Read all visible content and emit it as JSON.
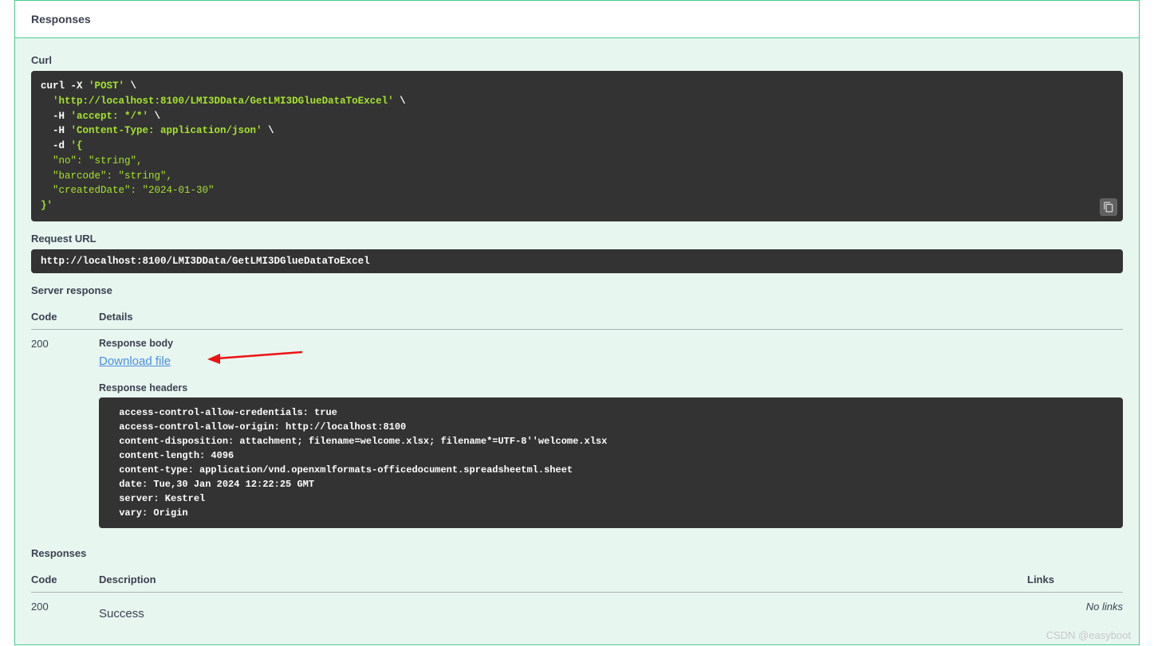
{
  "header": {
    "title": "Responses"
  },
  "curl": {
    "label": "Curl",
    "prefix": "curl -X ",
    "method": "'POST'",
    "slash": " \\",
    "url": "'http://localhost:8100/LMI3DData/GetLMI3DGlueDataToExcel'",
    "h_flag": "  -H ",
    "accept": "'accept: */*'",
    "ctype": "'Content-Type: application/json'",
    "d_flag": "  -d ",
    "body_open": "'{",
    "body_no": "  \"no\": \"string\",",
    "body_barcode": "  \"barcode\": \"string\",",
    "body_date": "  \"createdDate\": \"2024-01-30\"",
    "body_close": "}'"
  },
  "request_url": {
    "label": "Request URL",
    "value": "http://localhost:8100/LMI3DData/GetLMI3DGlueDataToExcel"
  },
  "server_response": {
    "label": "Server response",
    "code_header": "Code",
    "details_header": "Details",
    "code": "200",
    "body_label": "Response body",
    "download_text": "Download file",
    "headers_label": "Response headers",
    "headers_text": " access-control-allow-credentials: true \n access-control-allow-origin: http://localhost:8100 \n content-disposition: attachment; filename=welcome.xlsx; filename*=UTF-8''welcome.xlsx \n content-length: 4096 \n content-type: application/vnd.openxmlformats-officedocument.spreadsheetml.sheet \n date: Tue,30 Jan 2024 12:22:25 GMT \n server: Kestrel \n vary: Origin "
  },
  "responses2": {
    "label": "Responses",
    "code_header": "Code",
    "desc_header": "Description",
    "links_header": "Links",
    "code": "200",
    "desc": "Success",
    "no_links": "No links"
  },
  "watermark": "CSDN @easyboot"
}
